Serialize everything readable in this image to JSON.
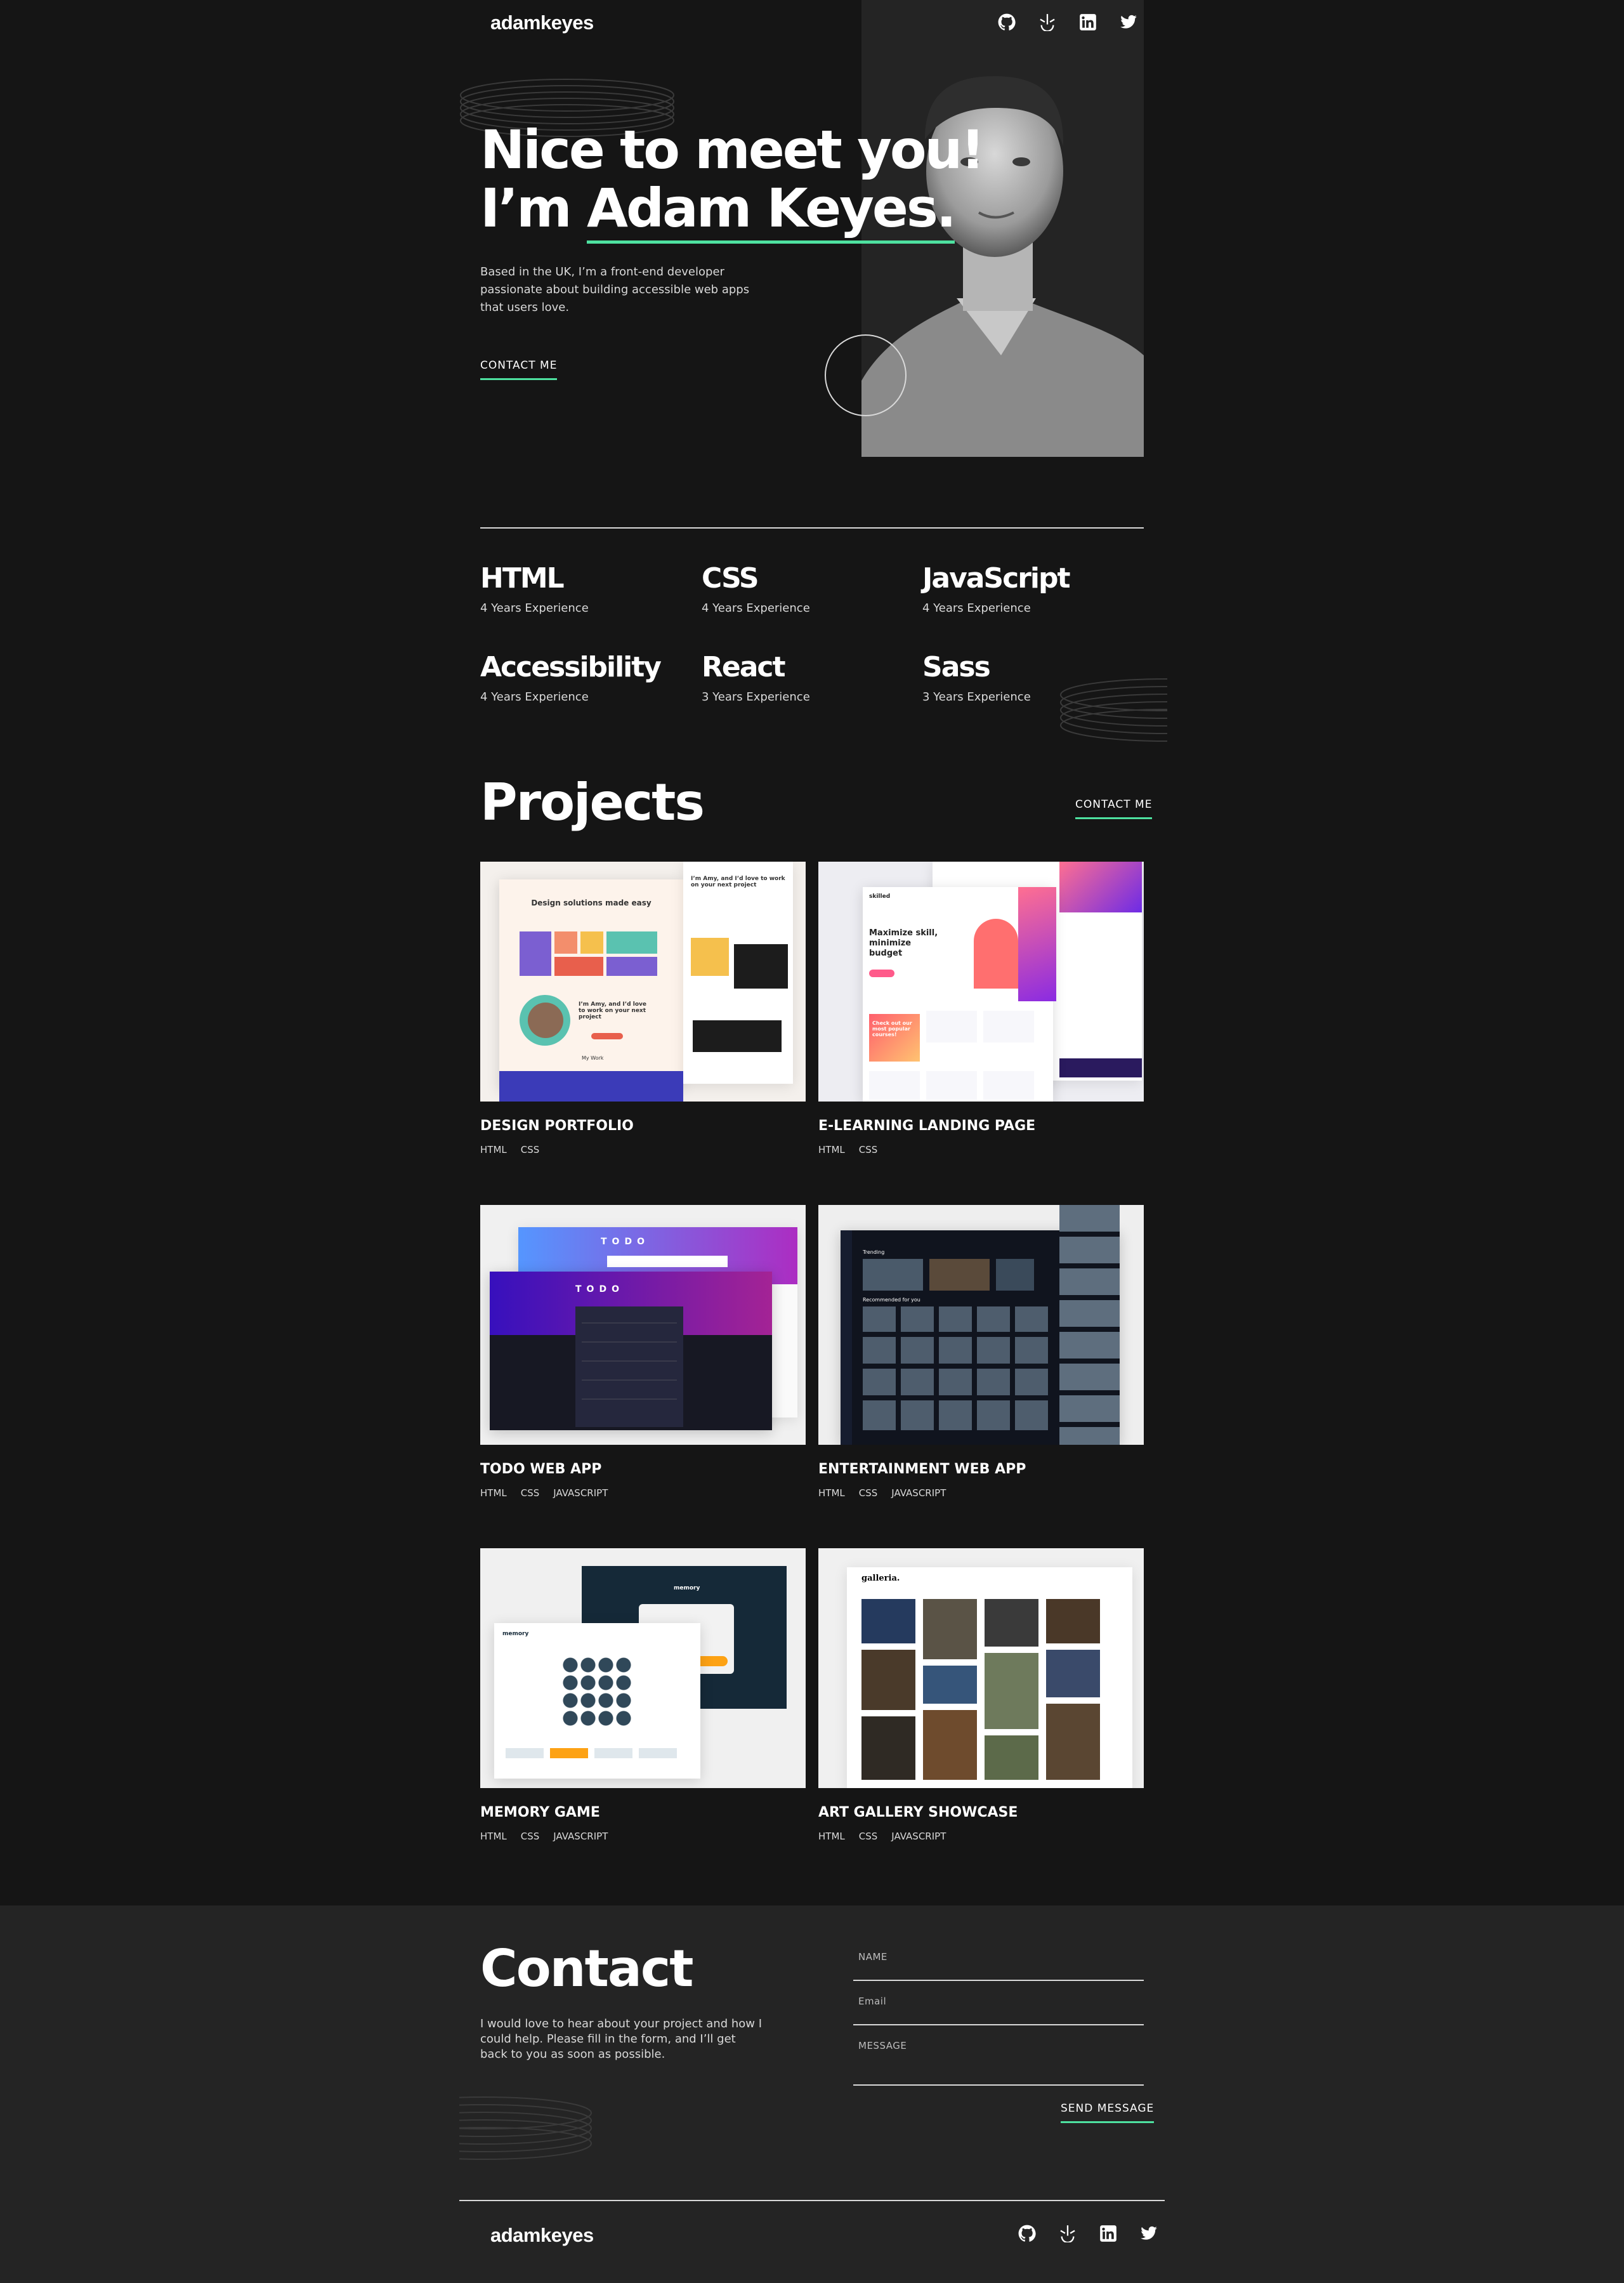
{
  "header": {
    "logo": "adamkeyes",
    "social": [
      {
        "name": "github-icon"
      },
      {
        "name": "frontend-mentor-icon"
      },
      {
        "name": "linkedin-icon"
      },
      {
        "name": "twitter-icon"
      }
    ]
  },
  "hero": {
    "title_line1": "Nice to meet you!",
    "title_prefix": "I’m ",
    "title_name": "Adam Keyes.",
    "description": "Based in the UK, I’m a front-end developer passionate about building accessible web apps that users love.",
    "cta": "CONTACT ME"
  },
  "skills": [
    {
      "name": "HTML",
      "experience": "4 Years Experience"
    },
    {
      "name": "CSS",
      "experience": "4 Years Experience"
    },
    {
      "name": "JavaScript",
      "experience": "4 Years Experience"
    },
    {
      "name": "Accessibility",
      "experience": "4 Years Experience"
    },
    {
      "name": "React",
      "experience": "3 Years Experience"
    },
    {
      "name": "Sass",
      "experience": "3 Years Experience"
    }
  ],
  "projects": {
    "title": "Projects",
    "cta": "CONTACT ME",
    "items": [
      {
        "title": "DESIGN PORTFOLIO",
        "tags": [
          "HTML",
          "CSS"
        ],
        "thumb_heading": "Design solutions made easy",
        "thumb_sub": "I’m Amy, and I’d love to work on your next project",
        "thumb_caption": "My Work"
      },
      {
        "title": "E-LEARNING LANDING PAGE",
        "tags": [
          "HTML",
          "CSS"
        ],
        "thumb_heading": "Maximize skill, minimize budget",
        "thumb_sub": "skilled",
        "thumb_caption": "Check out our most popular courses!"
      },
      {
        "title": "TODO WEB APP",
        "tags": [
          "HTML",
          "CSS",
          "JAVASCRIPT"
        ],
        "thumb_heading": "TODO",
        "thumb_sub": "",
        "thumb_caption": ""
      },
      {
        "title": "ENTERTAINMENT WEB APP",
        "tags": [
          "HTML",
          "CSS",
          "JAVASCRIPT"
        ],
        "thumb_heading": "Trending",
        "thumb_sub": "Recommended for you",
        "thumb_caption": ""
      },
      {
        "title": "MEMORY GAME",
        "tags": [
          "HTML",
          "CSS",
          "JAVASCRIPT"
        ],
        "thumb_heading": "memory",
        "thumb_sub": "memory",
        "thumb_caption": ""
      },
      {
        "title": "ART GALLERY SHOWCASE",
        "tags": [
          "HTML",
          "CSS",
          "JAVASCRIPT"
        ],
        "thumb_heading": "galleria.",
        "thumb_sub": "",
        "thumb_caption": ""
      }
    ]
  },
  "contact": {
    "title": "Contact",
    "description": "I would love to hear about your project and how I could help. Please fill in the form, and I’ll get back to you as soon as possible.",
    "name_placeholder": "NAME",
    "email_placeholder": "Email",
    "message_placeholder": "MESSAGE",
    "submit": "SEND MESSAGE"
  },
  "footer": {
    "logo": "adamkeyes"
  },
  "colors": {
    "background": "#151515",
    "surface": "#242424",
    "accent": "#4ee1a0",
    "text": "#ffffff",
    "muted": "#d9d9d9"
  }
}
